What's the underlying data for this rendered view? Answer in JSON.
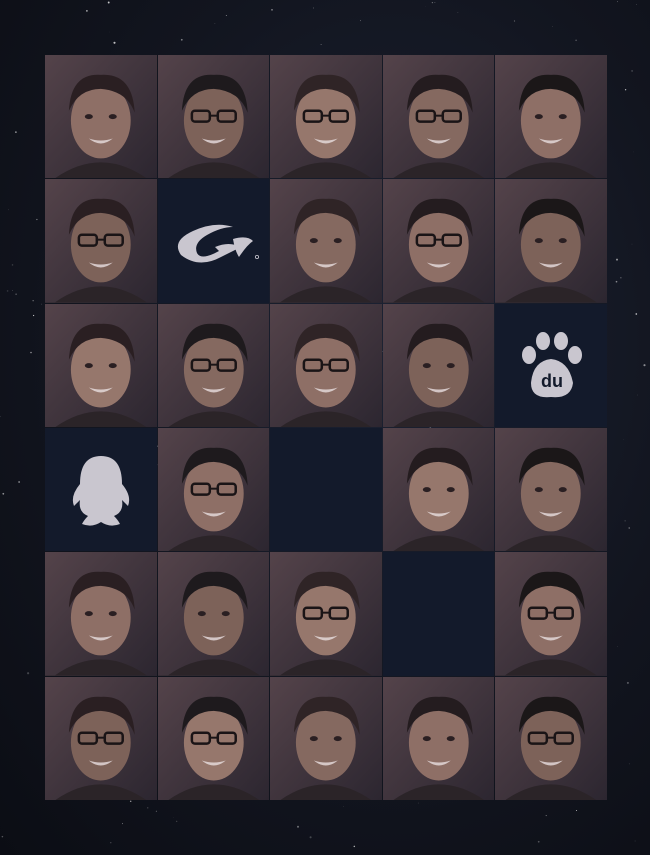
{
  "grid": {
    "cells": [
      {
        "kind": "photo",
        "name": "person"
      },
      {
        "kind": "photo",
        "name": "person-glasses"
      },
      {
        "kind": "photo",
        "name": "person-glasses"
      },
      {
        "kind": "photo",
        "name": "person-glasses"
      },
      {
        "kind": "photo",
        "name": "person"
      },
      {
        "kind": "photo",
        "name": "person-glasses"
      },
      {
        "kind": "logo",
        "name": "alibaba-logo-icon"
      },
      {
        "kind": "photo",
        "name": "person"
      },
      {
        "kind": "photo",
        "name": "person-glasses"
      },
      {
        "kind": "photo",
        "name": "person"
      },
      {
        "kind": "photo",
        "name": "person"
      },
      {
        "kind": "photo",
        "name": "person-glasses"
      },
      {
        "kind": "photo",
        "name": "person-glasses"
      },
      {
        "kind": "photo",
        "name": "person"
      },
      {
        "kind": "logo",
        "name": "baidu-paw-logo-icon"
      },
      {
        "kind": "logo",
        "name": "qq-penguin-logo-icon"
      },
      {
        "kind": "photo",
        "name": "person-glasses"
      },
      {
        "kind": "empty",
        "name": "empty-tile"
      },
      {
        "kind": "photo",
        "name": "person"
      },
      {
        "kind": "photo",
        "name": "person"
      },
      {
        "kind": "photo",
        "name": "person"
      },
      {
        "kind": "photo",
        "name": "person"
      },
      {
        "kind": "photo",
        "name": "person-glasses"
      },
      {
        "kind": "empty",
        "name": "empty-tile"
      },
      {
        "kind": "photo",
        "name": "person-glasses"
      },
      {
        "kind": "photo",
        "name": "person-glasses"
      },
      {
        "kind": "photo",
        "name": "person-glasses"
      },
      {
        "kind": "photo",
        "name": "person"
      },
      {
        "kind": "photo",
        "name": "person"
      },
      {
        "kind": "photo",
        "name": "person-glasses"
      }
    ]
  },
  "logos": {
    "baidu_text": "du"
  },
  "colors": {
    "background": "#12151f",
    "tile_dark": "#131a2b",
    "photo_tint": "#4a3b3e",
    "logo_fill": "#c9c6cf"
  }
}
